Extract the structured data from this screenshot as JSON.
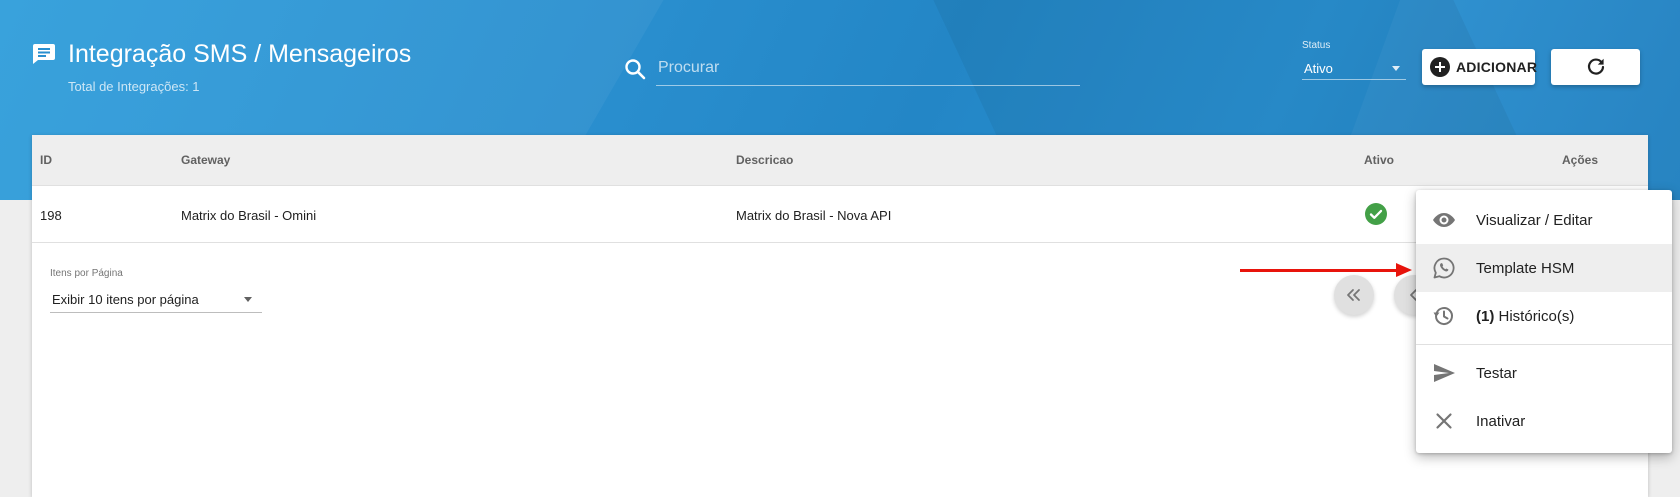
{
  "header": {
    "title": "Integração SMS / Mensageiros",
    "subtitle": "Total de Integrações: 1"
  },
  "search": {
    "placeholder": "Procurar",
    "value": ""
  },
  "status_filter": {
    "label": "Status",
    "value": "Ativo"
  },
  "toolbar": {
    "add_label": "ADICIONAR"
  },
  "table": {
    "columns": [
      "ID",
      "Gateway",
      "Descricao",
      "Ativo",
      "Ações"
    ],
    "rows": [
      {
        "id": "198",
        "gateway": "Matrix do Brasil - Omini",
        "descricao": "Matrix do Brasil - Nova API",
        "ativo": true
      }
    ]
  },
  "pagination": {
    "per_page_label": "Itens por Página",
    "per_page_value": "Exibir 10 itens por página"
  },
  "context_menu": {
    "items": [
      {
        "label": "Visualizar / Editar",
        "icon": "eye-icon"
      },
      {
        "label": "Template HSM",
        "icon": "whatsapp-icon"
      },
      {
        "count": "(1)",
        "label": "Histórico(s)",
        "icon": "history-icon"
      },
      {
        "label": "Testar",
        "icon": "send-icon"
      },
      {
        "label": "Inativar",
        "icon": "close-icon"
      }
    ]
  },
  "colors": {
    "header_bg": "#2a8fcf",
    "active_check": "#43a047",
    "annotation_arrow": "#e8140c"
  }
}
